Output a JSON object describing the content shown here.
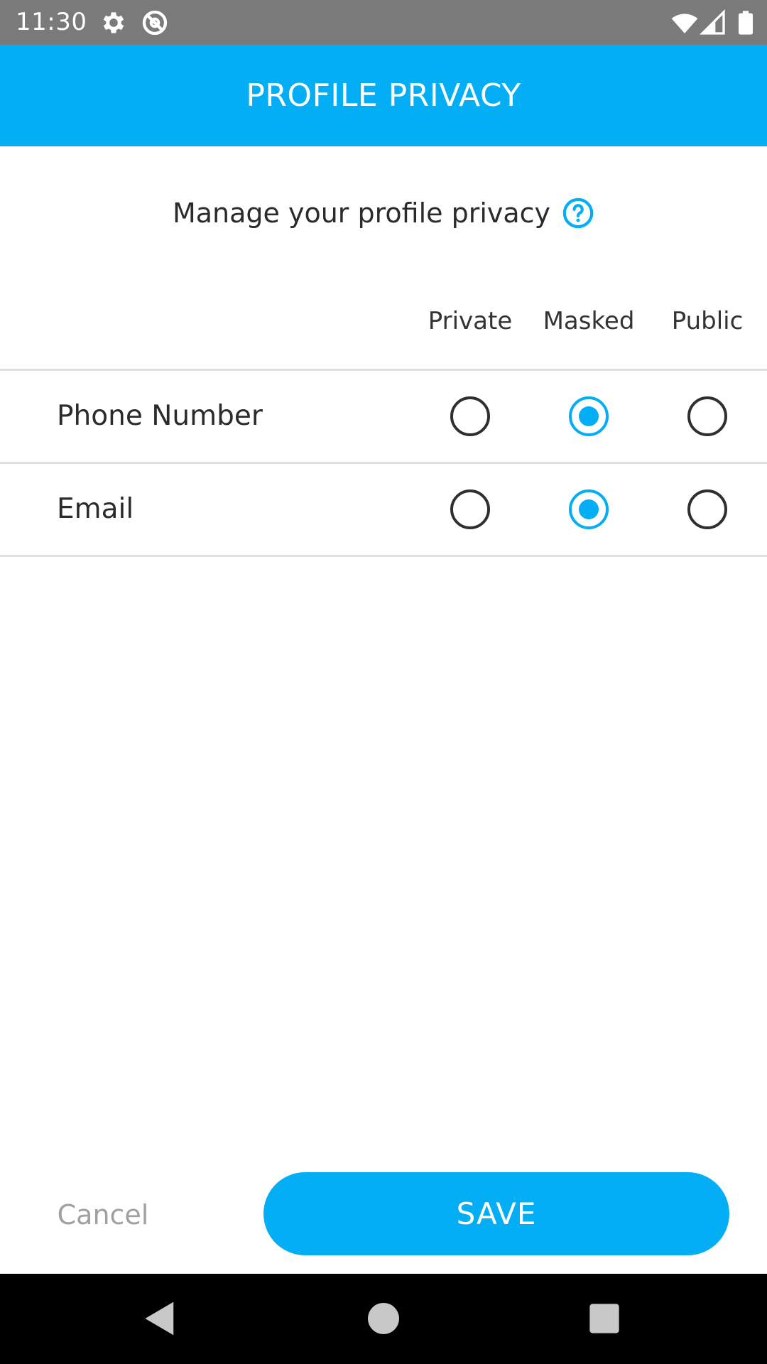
{
  "status_bar": {
    "time": "11:30",
    "icons": [
      "gear-icon",
      "no-sync-icon",
      "wifi-icon",
      "signal-icon",
      "battery-icon"
    ]
  },
  "app_bar": {
    "title": "PROFILE PRIVACY"
  },
  "subtitle": {
    "text": "Manage your profile privacy",
    "icon": "help-icon"
  },
  "columns": [
    "Private",
    "Masked",
    "Public"
  ],
  "rows": [
    {
      "label": "Phone Number",
      "selected": "Masked"
    },
    {
      "label": "Email",
      "selected": "Masked"
    }
  ],
  "actions": {
    "cancel_label": "Cancel",
    "save_label": "SAVE"
  },
  "nav_bar": {
    "icons": [
      "back-icon",
      "home-icon",
      "recents-icon"
    ]
  },
  "colors": {
    "accent": "#03aef5",
    "status_bar": "#7a7a7a",
    "nav_bar": "#000000",
    "text_primary": "#2b2b2b",
    "text_muted": "#a0a0a0"
  }
}
